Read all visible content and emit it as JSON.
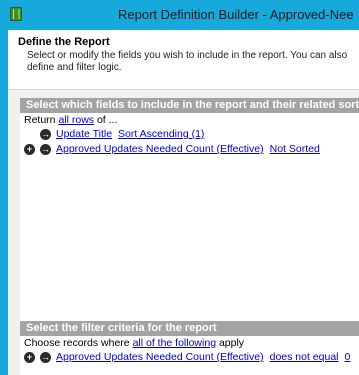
{
  "window": {
    "title": "Report Definition Builder - Approved-Nee"
  },
  "header": {
    "title": "Define the Report",
    "description": "Select or modify the fields you wish to include in the report. You can also define and filter logic."
  },
  "fields_section": {
    "header": "Select which fields to include in the report and their related sort order",
    "intro_prefix": "Return",
    "intro_link": "all rows",
    "intro_suffix": "of ...",
    "rows": [
      {
        "field": "Update Title",
        "sort": "Sort Ascending (1)",
        "add_symbol": "+",
        "arrow_symbol": "→"
      },
      {
        "field": "Approved Updates Needed Count (Effective)",
        "sort": "Not Sorted",
        "add_symbol": "+",
        "arrow_symbol": "→"
      }
    ]
  },
  "filter_section": {
    "header": "Select the filter criteria for the report",
    "intro_prefix": "Choose records where",
    "intro_link": "all of the following",
    "intro_suffix": "apply",
    "rows": [
      {
        "field": "Approved Updates Needed Count (Effective)",
        "operator": "does not equal",
        "value": "0",
        "add_symbol": "+",
        "arrow_symbol": "→"
      }
    ]
  }
}
